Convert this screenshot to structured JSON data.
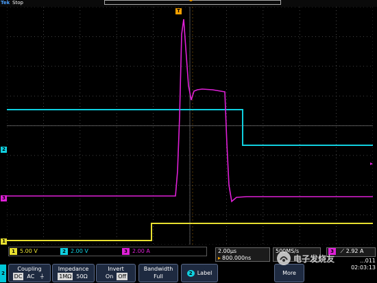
{
  "toolbar": {
    "brand": "Tek",
    "acquisition_state": "Stop"
  },
  "trigger": {
    "marker_label": "T",
    "readout_icon": "trigger-rising-edge-icon",
    "readout_value": "2.92 A"
  },
  "channels": [
    {
      "number": "1",
      "scale": "5.00 V",
      "color": "#e8e030"
    },
    {
      "number": "2",
      "scale": "2.00 V",
      "color": "#10d0e0"
    },
    {
      "number": "3",
      "scale": "2.00 A",
      "color": "#e020d8"
    }
  ],
  "horizontal": {
    "timebase": "2.00µs",
    "position": "800.000ns",
    "sample_rate": "500MS/s"
  },
  "timestamp": {
    "date": "...011",
    "time": "02:03:13"
  },
  "menu": {
    "side_tab": "2",
    "coupling": {
      "title": "Coupling",
      "options": [
        "DC",
        "AC",
        "⏚"
      ],
      "selected": 0
    },
    "impedance": {
      "title": "Impedance",
      "options": [
        "1MΩ",
        "50Ω"
      ],
      "selected": 0
    },
    "invert": {
      "title": "Invert",
      "options": [
        "On",
        "Off"
      ],
      "selected": 1
    },
    "bandwidth": {
      "title": "Bandwidth",
      "value": "Full"
    },
    "label": {
      "badge": "2",
      "title": "Label"
    },
    "more": "More"
  },
  "watermark": {
    "text": "电子发烧友",
    "logo_icon": "elecfans-logo-icon"
  },
  "colors": {
    "ch1": "#e8e030",
    "ch2": "#10d0e0",
    "ch3": "#e020d8",
    "trigger": "#f5a000",
    "grid": "#5a5a5a"
  }
}
